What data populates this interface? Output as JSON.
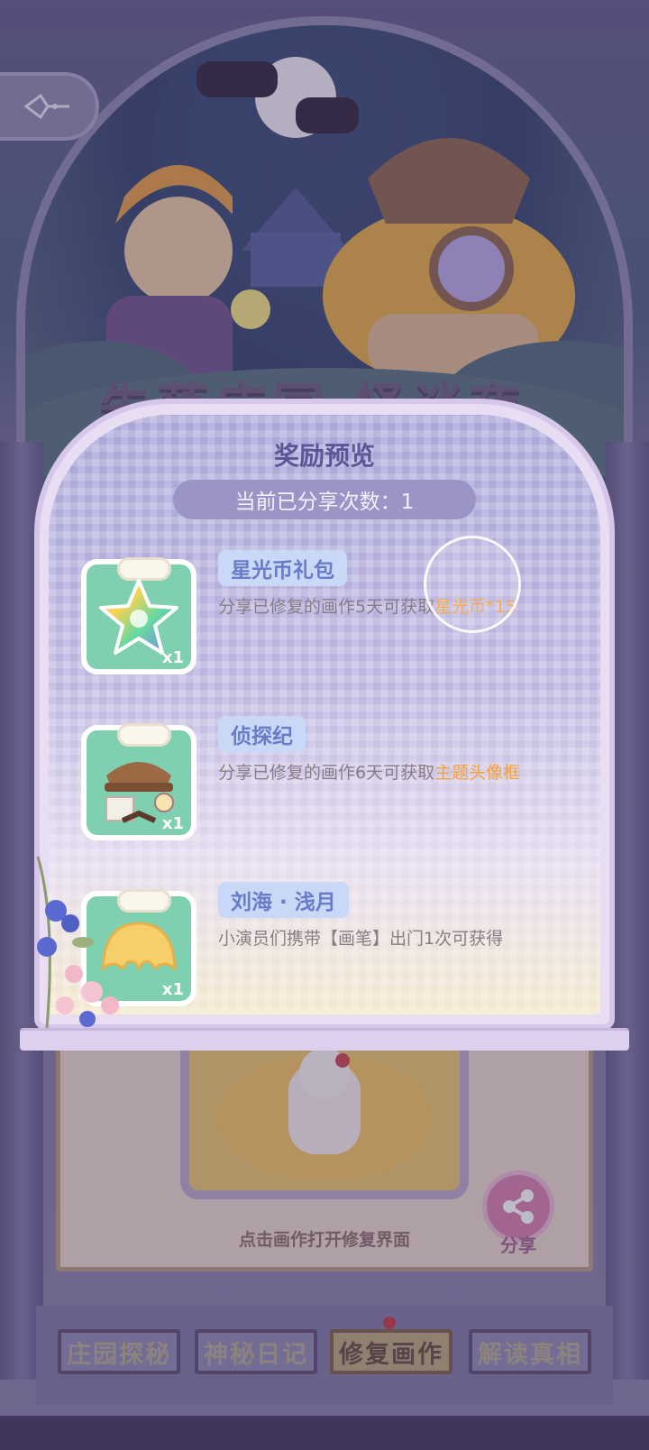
{
  "background": {
    "event_title": "失落庄园·怪谈夜",
    "painting_hint": "点击画作打开修复界面",
    "share_label": "分享"
  },
  "tabs": [
    {
      "label": "庄园探秘",
      "active": false
    },
    {
      "label": "神秘日记",
      "active": false
    },
    {
      "label": "修复画作",
      "active": true
    },
    {
      "label": "解读真相",
      "active": false
    }
  ],
  "modal": {
    "title": "奖励预览",
    "share_count_label": "当前已分享次数：1",
    "rewards": [
      {
        "name": "星光币礼包",
        "qty": "x1",
        "desc_prefix": "分享已修复的画作5天可获取",
        "desc_highlight": "星光币*15",
        "icon": "rainbow-star-icon"
      },
      {
        "name": "侦探纪",
        "qty": "x1",
        "desc_prefix": "分享已修复的画作6天可获取",
        "desc_highlight": "主题头像框",
        "icon": "detective-frame-icon"
      },
      {
        "name": "刘海 · 浅月",
        "qty": "x1",
        "desc_prefix": "小演员们携带【画笔】出门1次可获得",
        "desc_highlight": "",
        "icon": "bangs-hair-icon"
      }
    ]
  },
  "colors": {
    "accent_orange": "#f5a13a",
    "title_purple": "#5d5596",
    "gift_green": "#7fcfb1"
  }
}
